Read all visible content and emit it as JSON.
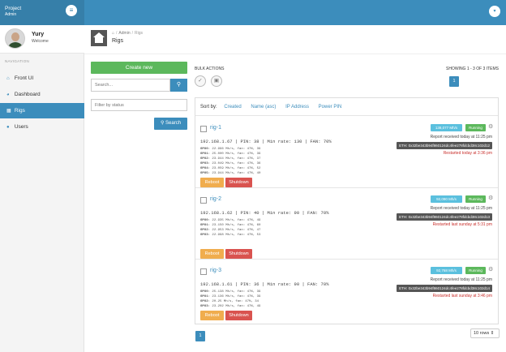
{
  "topbar": {
    "brand_title": "Project",
    "brand_sub": "Admin",
    "menu_icon": "hamburger-icon",
    "dropdown_icon": "caret-down-icon"
  },
  "user": {
    "name": "Yury",
    "welcome": "Welcome"
  },
  "sidebar": {
    "header": "NAVIGATION",
    "items": [
      {
        "label": "Front UI",
        "icon": "home-icon"
      },
      {
        "label": "Dashboard",
        "icon": "dashboard-icon"
      },
      {
        "label": "Rigs",
        "icon": "server-icon",
        "active": true
      },
      {
        "label": "Users",
        "icon": "users-icon"
      }
    ]
  },
  "breadcrumb": {
    "admin": "Admin",
    "rigs": "Rigs",
    "title": "Rigs"
  },
  "filters": {
    "create_label": "Create new",
    "search_placeholder": "Search...",
    "status_placeholder": "Filter by status",
    "search_button": "Search"
  },
  "bulk": {
    "label": "BULK ACTIONS"
  },
  "showing": "SHOWING 1 - 3 OF 3 ITEMS",
  "pagination": {
    "top_page": "1",
    "bottom_page": "1"
  },
  "sort": {
    "label": "Sort by:",
    "options": [
      "Created",
      "Name (asc)",
      "IP Address",
      "Power PIN"
    ]
  },
  "rigs": [
    {
      "name": "rig-1",
      "info": "192.168.1.67 | PIN: 38 | Min rate: 130 | FAN: 70%",
      "gpus": [
        {
          "label": "GPU0:",
          "text": "22.996 Mh/s, fan: 47%, 39"
        },
        {
          "label": "GPU1:",
          "text": "25.000 Mh/s, fan: 47%, 39"
        },
        {
          "label": "GPU2:",
          "text": "23.944 Mh/s, fan: 47%, 37"
        },
        {
          "label": "GPU3:",
          "text": "23.049 Mh/s, fan: 47%, 36"
        },
        {
          "label": "GPU4:",
          "text": "23.059 Mh/s, fan: 47%, 52"
        },
        {
          "label": "GPU5:",
          "text": "23.944 Mh/s, fan: 47%, 40"
        }
      ],
      "rate": "138,077 Mh/s",
      "status": "Running",
      "report": "Report received today at 11:25 pm",
      "eth": "ETH: 0x32be343b94f860124dc4fee278fdcbd38c102d12",
      "restart": "Restarted today at 3:36 pm",
      "reboot": "Reboot",
      "shutdown": "Shutdown"
    },
    {
      "name": "rig-2",
      "info": "192.168.1.62 | PIN: 40 | Min rate: 90 | FAN: 70%",
      "gpus": [
        {
          "label": "GPU0:",
          "text": "22.935 Mh/s, fan: 47%, 49"
        },
        {
          "label": "GPU1:",
          "text": "23.150 Mh/s, fan: 47%, 60"
        },
        {
          "label": "GPU2:",
          "text": "22.953 Mh/s, fan: 47%, 47"
        },
        {
          "label": "GPU3:",
          "text": "22.998 Mh/s, fan: 47%, 53"
        }
      ],
      "rate": "92,090 Mh/s",
      "status": "Running",
      "report": "Report received today at 11:25 pm",
      "eth": "ETH: 0x32be343b94f860124dc4fee278fdcbd38c102d13",
      "restart": "Restarted last sunday at 5:31 pm",
      "reboot": "Reboot",
      "shutdown": "Shutdown"
    },
    {
      "name": "rig-3",
      "info": "192.168.1.61 | PIN: 36 | Min rate: 90 | FAN: 70%",
      "gpus": [
        {
          "label": "GPU0:",
          "text": "25.138 Mh/s, fan: 47%, 39"
        },
        {
          "label": "GPU1:",
          "text": "23.136 Mh/s, fan: 47%, 39"
        },
        {
          "label": "GPU2:",
          "text": "20.25 Mh/s, fan: 47%, 34"
        },
        {
          "label": "GPU3:",
          "text": "23.202 Mh/s, fan: 47%, 49"
        }
      ],
      "rate": "92,768 Mh/s",
      "status": "Running",
      "report": "Report received today at 11:25 pm",
      "eth": "ETH: 0x32be343b94f860124dc4fee278fdcbd38c102d14",
      "restart": "Restarted last sunday at 3:46 pm",
      "reboot": "Reboot",
      "shutdown": "Shutdown"
    }
  ],
  "rows_select": "10 rows",
  "colors": {
    "primary": "#3c8dbc",
    "success": "#5cb85c",
    "warning": "#f0ad4e",
    "danger": "#d9534f",
    "info": "#5bc0de"
  }
}
